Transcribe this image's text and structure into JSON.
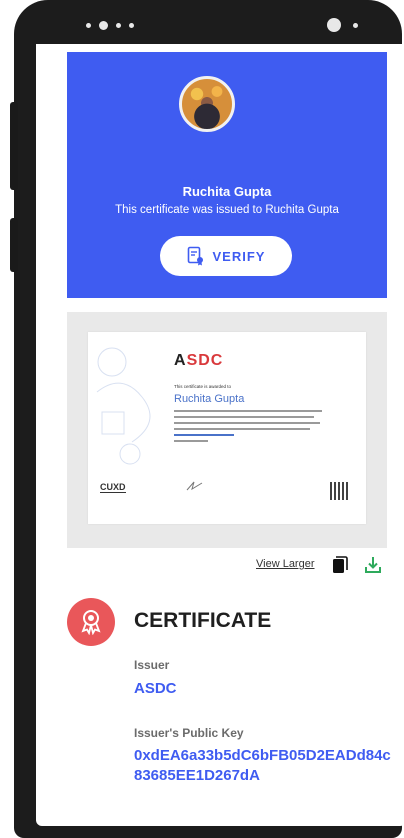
{
  "profile": {
    "name": "Ruchita Gupta",
    "issued_text": "This certificate was issued to Ruchita Gupta",
    "verify_label": "VERIFY"
  },
  "certificate_preview": {
    "logo_prefix": "A",
    "logo_highlight": "SDC",
    "awarded_text": "This certificate is awarded to",
    "recipient": "Ruchita Gupta",
    "cuxd_mark": "CUXD"
  },
  "actions": {
    "view_larger": "View Larger"
  },
  "details": {
    "title": "CERTIFICATE",
    "issuer_label": "Issuer",
    "issuer_value": "ASDC",
    "key_label": "Issuer's Public Key",
    "key_value": "0xdEA6a33b5dC6bFB05D2EADd84c83685EE1D267dA"
  },
  "colors": {
    "primary": "#3f5cf1",
    "badge": "#e9575a",
    "download": "#2eaa5c"
  }
}
